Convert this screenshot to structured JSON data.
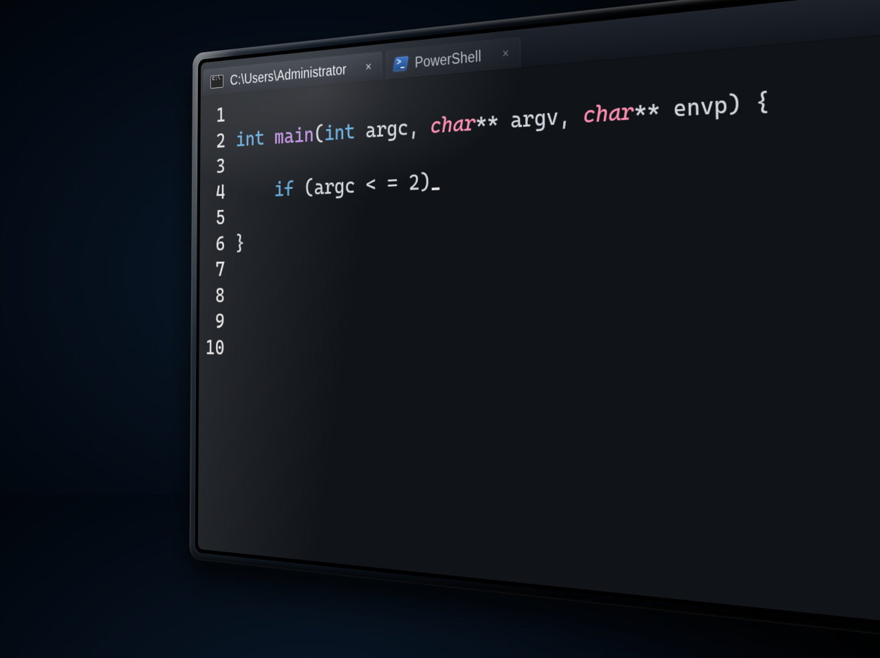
{
  "tabs": {
    "active": {
      "icon": "cmd-icon",
      "title": "C:\\Users\\Administrator",
      "close": "×"
    },
    "inactive": {
      "icon": "ps-icon",
      "title": "PowerShell",
      "close": "×"
    }
  },
  "titlebar_extras": {
    "orange_badge": true,
    "overflow_glyph": "–"
  },
  "editor": {
    "line_numbers": [
      "1",
      "2",
      "3",
      "4",
      "5",
      "6",
      "7",
      "8",
      "9",
      "10"
    ],
    "code": {
      "l1": {
        "kw_int": "int",
        "fn": "main",
        "open": "(",
        "kw_int2": "int",
        "argc": " argc",
        "comma1": ", ",
        "char1": "char",
        "stars1": "** ",
        "argv": "argv",
        "comma2": ", ",
        "char2": "char",
        "stars2": "** ",
        "envp": "envp",
        "close": ") ",
        "brace": "{"
      },
      "l2": {
        "indent": "    ",
        "kw_if": "if",
        "open": " (",
        "argc": "argc",
        "op": " < = ",
        "num": "2",
        "close": ")"
      },
      "l3": {
        "brace": "}"
      }
    }
  }
}
